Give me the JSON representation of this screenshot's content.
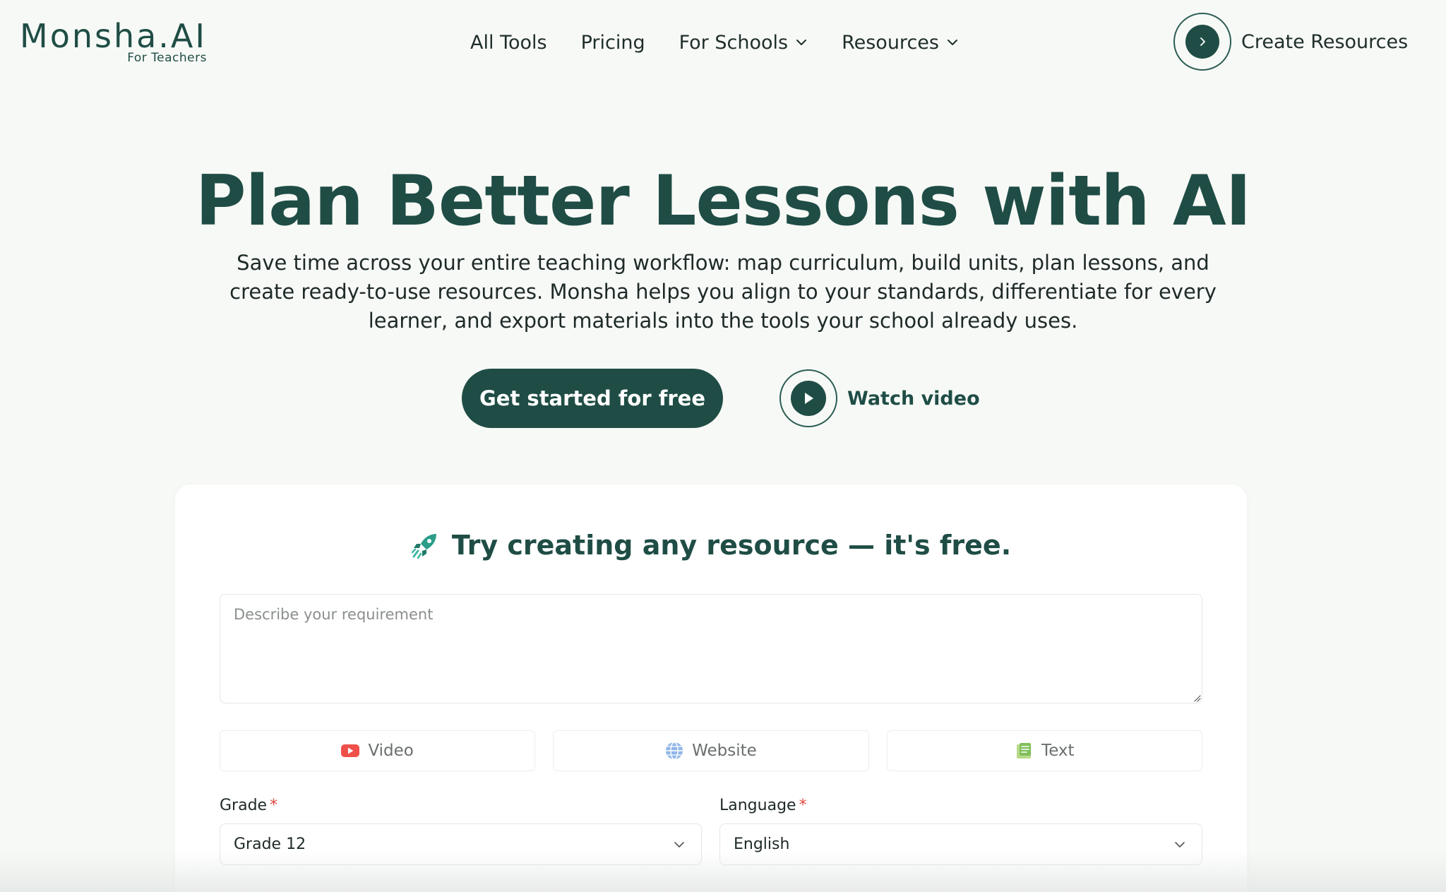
{
  "logo": {
    "name": "Monsha.AI",
    "tagline": "For Teachers"
  },
  "nav": {
    "items": [
      {
        "label": "All Tools",
        "dropdown": false
      },
      {
        "label": "Pricing",
        "dropdown": false
      },
      {
        "label": "For Schools",
        "dropdown": true
      },
      {
        "label": "Resources",
        "dropdown": true
      }
    ],
    "create_label": "Create Resources"
  },
  "hero": {
    "title": "Plan Better Lessons with AI",
    "subtitle": "Save time across your entire teaching workflow: map curriculum, build units, plan lessons, and create ready-to-use resources. Monsha helps you align to your standards, differentiate for every learner, and export materials into the tools your school already uses.",
    "primary_cta": "Get started for free",
    "secondary_cta": "Watch video"
  },
  "card": {
    "title": "Try creating any resource — it's free.",
    "requirement_placeholder": "Describe your requirement",
    "sources": [
      {
        "label": "Video",
        "icon": "youtube-icon"
      },
      {
        "label": "Website",
        "icon": "globe-icon"
      },
      {
        "label": "Text",
        "icon": "document-icon"
      }
    ],
    "grade": {
      "label": "Grade",
      "required_mark": "*",
      "value": "Grade 12"
    },
    "language": {
      "label": "Language",
      "required_mark": "*",
      "value": "English"
    }
  },
  "colors": {
    "brand": "#1f4d45",
    "background": "#f7f9f6",
    "required": "#e0483e"
  }
}
